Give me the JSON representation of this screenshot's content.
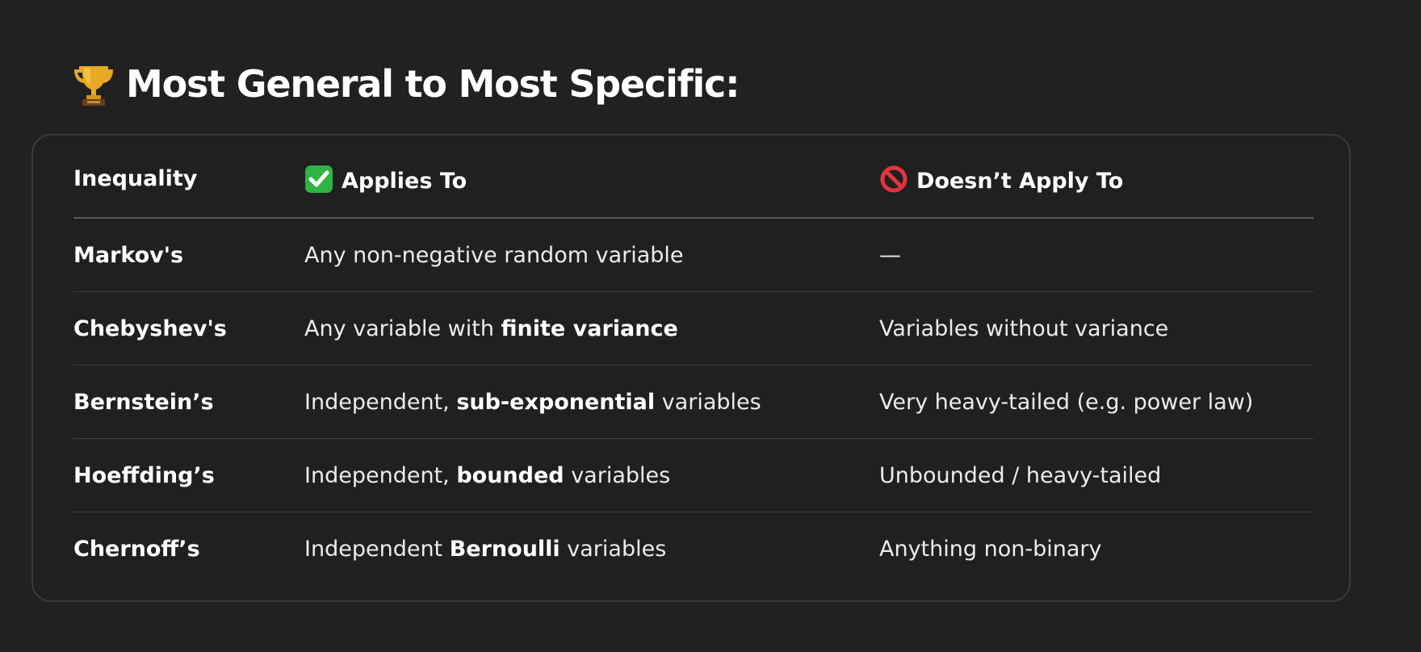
{
  "heading": {
    "emoji": "trophy-icon",
    "text": "Most General to Most Specific:"
  },
  "table": {
    "headers": [
      {
        "label": "Inequality",
        "icon": null
      },
      {
        "label": "Applies To",
        "icon": "check-mark-icon"
      },
      {
        "label": "Doesn’t Apply To",
        "icon": "prohibited-icon"
      }
    ],
    "rows": [
      {
        "name": "Markov's",
        "applies": [
          {
            "text": "Any non-negative random variable",
            "bold": false
          }
        ],
        "not_applies": "—"
      },
      {
        "name": "Chebyshev's",
        "applies": [
          {
            "text": "Any variable with ",
            "bold": false
          },
          {
            "text": "finite variance",
            "bold": true
          }
        ],
        "not_applies": "Variables without variance"
      },
      {
        "name": "Bernstein’s",
        "applies": [
          {
            "text": "Independent, ",
            "bold": false
          },
          {
            "text": "sub-exponential",
            "bold": true
          },
          {
            "text": " variables",
            "bold": false
          }
        ],
        "not_applies": "Very heavy-tailed (e.g. power law)"
      },
      {
        "name": "Hoeffding’s",
        "applies": [
          {
            "text": "Independent, ",
            "bold": false
          },
          {
            "text": "bounded",
            "bold": true
          },
          {
            "text": " variables",
            "bold": false
          }
        ],
        "not_applies": "Unbounded / heavy-tailed"
      },
      {
        "name": "Chernoff’s",
        "applies": [
          {
            "text": "Independent ",
            "bold": false
          },
          {
            "text": "Bernoulli",
            "bold": true
          },
          {
            "text": " variables",
            "bold": false
          }
        ],
        "not_applies": "Anything non-binary"
      }
    ]
  },
  "colors": {
    "background": "#212121",
    "card_border": "#3a3a3a",
    "text": "#ececec",
    "check_green": "#2fb344",
    "prohibited_red": "#e5343c",
    "trophy_gold": "#e9a825"
  }
}
